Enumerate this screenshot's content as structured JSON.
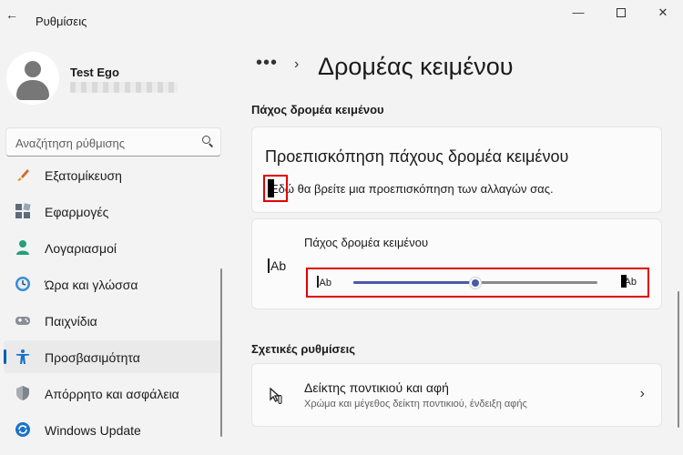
{
  "window": {
    "title": "Ρυθμίσεις",
    "back_glyph": "←",
    "minimize_glyph": "—",
    "close_glyph": "✕"
  },
  "profile": {
    "name": "Test Ego"
  },
  "search": {
    "placeholder": "Αναζήτηση ρύθμισης"
  },
  "sidebar": {
    "items": [
      {
        "label": "Εξατομίκευση",
        "icon": "brush-icon"
      },
      {
        "label": "Εφαρμογές",
        "icon": "apps-icon"
      },
      {
        "label": "Λογαριασμοί",
        "icon": "person-icon"
      },
      {
        "label": "Ώρα και γλώσσα",
        "icon": "clock-globe-icon"
      },
      {
        "label": "Παιχνίδια",
        "icon": "controller-icon"
      },
      {
        "label": "Προσβασιμότητα",
        "icon": "accessibility-icon",
        "active": true
      },
      {
        "label": "Απόρρητο και ασφάλεια",
        "icon": "shield-icon"
      },
      {
        "label": "Windows Update",
        "icon": "update-icon"
      }
    ]
  },
  "header": {
    "breadcrumb_dots": "•••",
    "breadcrumb_chevron": "›",
    "title": "Δρομέας κειμένου"
  },
  "section1": {
    "label": "Πάχος δρομέα κειμένου"
  },
  "preview": {
    "title": "Προεπισκόπηση πάχους δρομέα κειμένου",
    "text": "Εδώ θα βρείτε μια προεπισκόπηση των αλλαγών σας."
  },
  "thickness": {
    "icon_text": "Ab",
    "label": "Πάχος δρομέα κειμένου",
    "min_label": "Ab",
    "max_label": "Ab",
    "value_fraction": 0.5
  },
  "section2": {
    "label": "Σχετικές ρυθμίσεις"
  },
  "related": {
    "title": "Δείκτης ποντικιού και αφή",
    "subtitle": "Χρώμα και μέγεθος δείκτη ποντικιού, ένδειξη αφής",
    "chevron": "›",
    "icon": "mouse-pointer-icon"
  },
  "colors": {
    "accent": "#005fb8",
    "slider": "#4a5aa8",
    "highlight": "#e00000"
  }
}
